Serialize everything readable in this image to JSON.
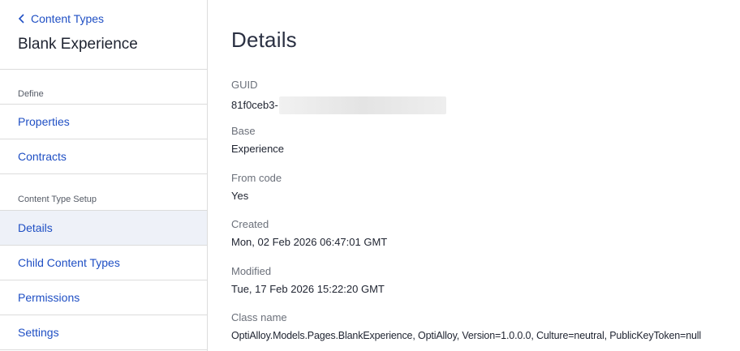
{
  "sidebar": {
    "back_label": "Content Types",
    "title": "Blank Experience",
    "sections": [
      {
        "label": "Define",
        "items": [
          {
            "label": "Properties"
          },
          {
            "label": "Contracts"
          }
        ]
      },
      {
        "label": "Content Type Setup",
        "items": [
          {
            "label": "Details",
            "active": true
          },
          {
            "label": "Child Content Types"
          },
          {
            "label": "Permissions"
          },
          {
            "label": "Settings"
          }
        ]
      }
    ]
  },
  "main": {
    "title": "Details",
    "fields": [
      {
        "label": "GUID",
        "value": "81f0ceb3-"
      },
      {
        "label": "Base",
        "value": "Experience"
      },
      {
        "label": "From code",
        "value": "Yes"
      },
      {
        "label": "Created",
        "value": "Mon, 02 Feb 2026 06:47:01 GMT"
      },
      {
        "label": "Modified",
        "value": "Tue, 17 Feb 2026 15:22:20 GMT"
      },
      {
        "label": "Class name",
        "value": "OptiAlloy.Models.Pages.BlankExperience, OptiAlloy, Version=1.0.0.0, Culture=neutral, PublicKeyToken=null"
      }
    ]
  },
  "colors": {
    "link": "#1f4fc4",
    "active_bg": "#eef1f8",
    "divider": "#dcdcdc"
  },
  "icons": {
    "back": "chevron-left-icon"
  }
}
